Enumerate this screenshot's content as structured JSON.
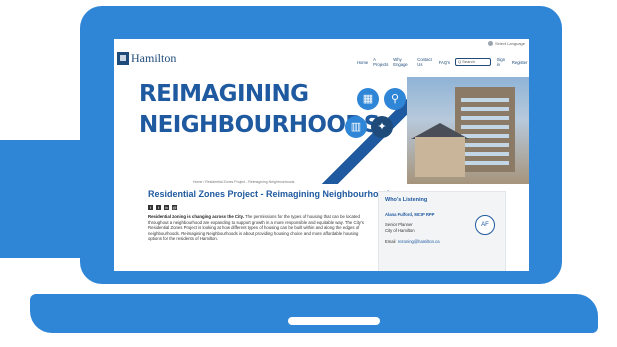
{
  "site": {
    "language": "Select Language",
    "brand": "Hamilton",
    "nav": [
      "Home",
      "A Projects",
      "Why Engage",
      "Contact Us",
      "FAQ's"
    ],
    "search_placeholder": "Q Search",
    "signin": "Sign in",
    "register": "Register"
  },
  "hero": {
    "title_line1": "REIMAGINING",
    "title_line2": "NEIGHBOURHOODS",
    "icons": [
      "housing-icon",
      "bikes-icon",
      "transit-icon",
      "chart-icon",
      "ideas-icon"
    ]
  },
  "page": {
    "breadcrumb": "Home / Residential Zones Project - Reimagining Neighbourhoods",
    "title": "Residential Zones Project - Reimagining Neighbourhoods",
    "body_lead": "Residential zoning is changing across the City.",
    "body_rest": " The permissions for the types of housing that can be located throughout a neighbourhood are expanding to support growth in a more responsible and equitable way. The City's Residential Zones Project is looking at how different types of housing can be built within and along the edges of neighbourhoods. Reimagining Neighbourhoods is about providing housing choice and more affordable housing options for the residents of Hamilton."
  },
  "listening": {
    "title": "Who's Listening",
    "name": "Alana Fulford, MCIP RPP",
    "role": "Senior Planner",
    "org": "City of Hamilton",
    "email_label": "Email",
    "email": "rezoning@hamilton.ca",
    "initials": "AF"
  },
  "colors": {
    "brand_blue": "#2f86d6",
    "navy": "#1e4b7a",
    "title_blue": "#1f5aa0"
  }
}
